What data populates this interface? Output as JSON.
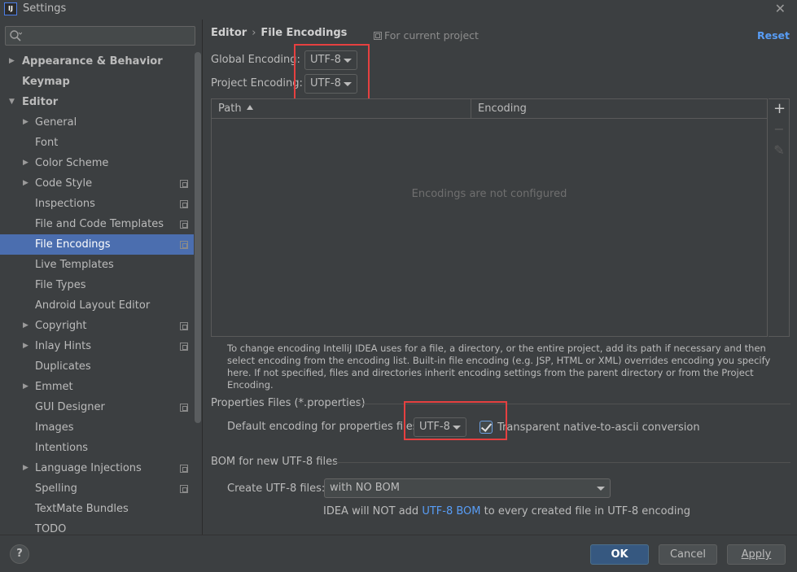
{
  "window": {
    "title": "Settings",
    "app_icon_text": "IJ"
  },
  "sidebar": {
    "search_placeholder": "",
    "items": [
      {
        "label": "Appearance & Behavior",
        "level": 0,
        "bold": true,
        "arrow": "right",
        "copy": false,
        "selected": false
      },
      {
        "label": "Keymap",
        "level": 0,
        "bold": true,
        "arrow": "",
        "copy": false,
        "selected": false
      },
      {
        "label": "Editor",
        "level": 0,
        "bold": true,
        "arrow": "down",
        "copy": false,
        "selected": false
      },
      {
        "label": "General",
        "level": 1,
        "bold": false,
        "arrow": "right",
        "copy": false,
        "selected": false
      },
      {
        "label": "Font",
        "level": 1,
        "bold": false,
        "arrow": "",
        "copy": false,
        "selected": false
      },
      {
        "label": "Color Scheme",
        "level": 1,
        "bold": false,
        "arrow": "right",
        "copy": false,
        "selected": false
      },
      {
        "label": "Code Style",
        "level": 1,
        "bold": false,
        "arrow": "right",
        "copy": true,
        "selected": false
      },
      {
        "label": "Inspections",
        "level": 1,
        "bold": false,
        "arrow": "",
        "copy": true,
        "selected": false
      },
      {
        "label": "File and Code Templates",
        "level": 1,
        "bold": false,
        "arrow": "",
        "copy": true,
        "selected": false
      },
      {
        "label": "File Encodings",
        "level": 1,
        "bold": false,
        "arrow": "",
        "copy": true,
        "selected": true
      },
      {
        "label": "Live Templates",
        "level": 1,
        "bold": false,
        "arrow": "",
        "copy": false,
        "selected": false
      },
      {
        "label": "File Types",
        "level": 1,
        "bold": false,
        "arrow": "",
        "copy": false,
        "selected": false
      },
      {
        "label": "Android Layout Editor",
        "level": 1,
        "bold": false,
        "arrow": "",
        "copy": false,
        "selected": false
      },
      {
        "label": "Copyright",
        "level": 1,
        "bold": false,
        "arrow": "right",
        "copy": true,
        "selected": false
      },
      {
        "label": "Inlay Hints",
        "level": 1,
        "bold": false,
        "arrow": "right",
        "copy": true,
        "selected": false
      },
      {
        "label": "Duplicates",
        "level": 1,
        "bold": false,
        "arrow": "",
        "copy": false,
        "selected": false
      },
      {
        "label": "Emmet",
        "level": 1,
        "bold": false,
        "arrow": "right",
        "copy": false,
        "selected": false
      },
      {
        "label": "GUI Designer",
        "level": 1,
        "bold": false,
        "arrow": "",
        "copy": true,
        "selected": false
      },
      {
        "label": "Images",
        "level": 1,
        "bold": false,
        "arrow": "",
        "copy": false,
        "selected": false
      },
      {
        "label": "Intentions",
        "level": 1,
        "bold": false,
        "arrow": "",
        "copy": false,
        "selected": false
      },
      {
        "label": "Language Injections",
        "level": 1,
        "bold": false,
        "arrow": "right",
        "copy": true,
        "selected": false
      },
      {
        "label": "Spelling",
        "level": 1,
        "bold": false,
        "arrow": "",
        "copy": true,
        "selected": false
      },
      {
        "label": "TextMate Bundles",
        "level": 1,
        "bold": false,
        "arrow": "",
        "copy": false,
        "selected": false
      },
      {
        "label": "TODO",
        "level": 1,
        "bold": false,
        "arrow": "",
        "copy": false,
        "selected": false
      }
    ]
  },
  "header": {
    "crumb_parent": "Editor",
    "crumb_sep": "›",
    "crumb_current": "File Encodings",
    "scope_note": "For current project",
    "reset_label": "Reset"
  },
  "encodings": {
    "global_label": "Global Encoding:",
    "global_value": "UTF-8",
    "project_label": "Project Encoding:",
    "project_value": "UTF-8"
  },
  "table": {
    "col_path": "Path",
    "col_encoding": "Encoding",
    "empty_message": "Encodings are not configured",
    "add_tool": "+",
    "remove_tool": "−",
    "edit_tool": "✎"
  },
  "help": {
    "text": "To change encoding IntelliJ IDEA uses for a file, a directory, or the entire project, add its path if necessary and then select encoding from the encoding list. Built-in file encoding (e.g. JSP, HTML or XML) overrides encoding you specify here. If not specified, files and directories inherit encoding settings from the parent directory or from the Project Encoding."
  },
  "properties": {
    "section_title": "Properties Files (*.properties)",
    "default_label": "Default encoding for properties files:",
    "default_value": "UTF-8",
    "native_ascii_label": "Transparent native-to-ascii conversion",
    "native_ascii_checked": true
  },
  "bom": {
    "section_title": "BOM for new UTF-8 files",
    "create_label": "Create UTF-8 files:",
    "create_value": "with NO BOM",
    "note_prefix": "IDEA will NOT add ",
    "note_link": "UTF-8 BOM",
    "note_suffix": " to every created file in UTF-8 encoding"
  },
  "footer": {
    "help_label": "?",
    "ok_label": "OK",
    "cancel_label": "Cancel",
    "apply_label": "Apply"
  },
  "colors": {
    "background": "#3c3f41",
    "selection": "#4b6eaf",
    "link": "#589df6",
    "highlight_box": "#e64040",
    "primary_button": "#365880"
  }
}
